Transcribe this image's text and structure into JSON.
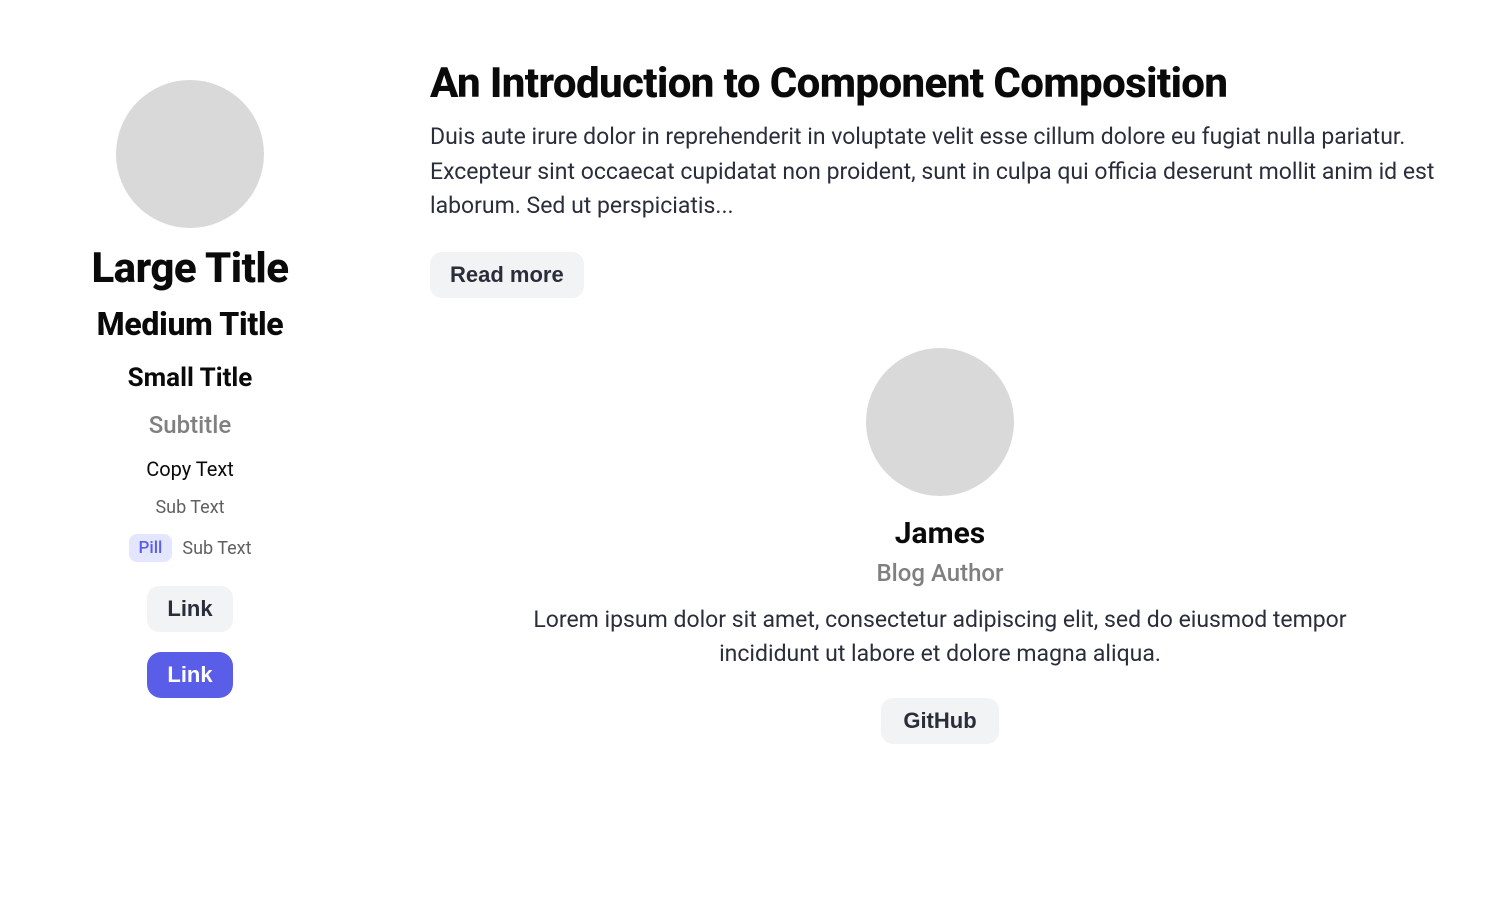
{
  "typography": {
    "large_title": "Large Title",
    "medium_title": "Medium Title",
    "small_title": "Small Title",
    "subtitle": "Subtitle",
    "copy_text": "Copy Text",
    "sub_text_1": "Sub Text",
    "pill_label": "Pill",
    "sub_text_2": "Sub Text",
    "link_light": "Link",
    "link_primary": "Link"
  },
  "article": {
    "title": "An Introduction to Component Composition",
    "body": "Duis aute irure dolor in reprehenderit in voluptate velit esse cillum dolore eu fugiat nulla pariatur. Excepteur sint occaecat cupidatat non proident, sunt in culpa qui officia deserunt mollit anim id est laborum. Sed ut perspiciatis...",
    "read_more_label": "Read more"
  },
  "author": {
    "name": "James",
    "role": "Blog Author",
    "bio": "Lorem ipsum dolor sit amet, consectetur adipiscing elit, sed do eiusmod tempor incididunt ut labore et dolore magna aliqua.",
    "github_label": "GitHub"
  }
}
